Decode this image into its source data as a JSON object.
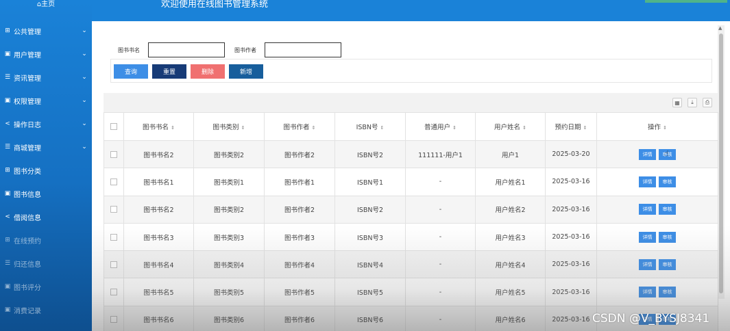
{
  "sidebar": {
    "home": "⌂主页",
    "items": [
      {
        "icon": "grid-icon",
        "glyph": "⊞",
        "label": "公共管理",
        "chevron": true
      },
      {
        "icon": "doc-icon",
        "glyph": "▣",
        "label": "用户管理",
        "chevron": true
      },
      {
        "icon": "list-icon",
        "glyph": "☰",
        "label": "资讯管理",
        "chevron": true
      },
      {
        "icon": "doc-icon",
        "glyph": "▣",
        "label": "权限管理",
        "chevron": true
      },
      {
        "icon": "share-icon",
        "glyph": "<",
        "label": "操作日志",
        "chevron": true
      },
      {
        "icon": "list-icon",
        "glyph": "☰",
        "label": "商城管理",
        "chevron": true
      },
      {
        "icon": "grid-icon",
        "glyph": "⊞",
        "label": "图书分类",
        "chevron": false
      },
      {
        "icon": "doc-icon",
        "glyph": "▣",
        "label": "图书信息",
        "chevron": false
      },
      {
        "icon": "share-icon",
        "glyph": "<",
        "label": "借阅信息",
        "chevron": false
      },
      {
        "icon": "grid-icon",
        "glyph": "⊞",
        "label": "在线预约",
        "chevron": false
      },
      {
        "icon": "list-icon",
        "glyph": "☰",
        "label": "归还信息",
        "chevron": false
      },
      {
        "icon": "doc-icon",
        "glyph": "▣",
        "label": "图书评分",
        "chevron": false
      },
      {
        "icon": "doc-icon",
        "glyph": "▣",
        "label": "消费记录",
        "chevron": false
      }
    ]
  },
  "header": {
    "title": "欢迎使用在线图书管理系统"
  },
  "search": {
    "name_label": "图书书名",
    "name_value": "",
    "author_label": "图书作者",
    "author_value": ""
  },
  "buttons": {
    "query": "查询",
    "reset": "重置",
    "delete": "删除",
    "add": "新增"
  },
  "table": {
    "columns": [
      "图书书名",
      "图书类别",
      "图书作者",
      "ISBN号",
      "普通用户",
      "用户姓名",
      "预约日期",
      "操作"
    ],
    "rows": [
      [
        "图书书名2",
        "图书类别2",
        "图书作者2",
        "ISBN号2",
        "111111-用户1",
        "用户1",
        "2025-03-20"
      ],
      [
        "图书书名1",
        "图书类别1",
        "图书作者1",
        "ISBN号1",
        "-",
        "用户姓名1",
        "2025-03-16"
      ],
      [
        "图书书名2",
        "图书类别2",
        "图书作者2",
        "ISBN号2",
        "-",
        "用户姓名2",
        "2025-03-16"
      ],
      [
        "图书书名3",
        "图书类别3",
        "图书作者3",
        "ISBN号3",
        "-",
        "用户姓名3",
        "2025-03-16"
      ],
      [
        "图书书名4",
        "图书类别4",
        "图书作者4",
        "ISBN号4",
        "-",
        "用户姓名4",
        "2025-03-16"
      ],
      [
        "图书书名5",
        "图书类别5",
        "图书作者5",
        "ISBN号5",
        "-",
        "用户姓名5",
        "2025-03-16"
      ],
      [
        "图书书名6",
        "图书类别6",
        "图书作者6",
        "ISBN号6",
        "-",
        "用户姓名6",
        "2025-03-16"
      ]
    ],
    "actions": {
      "detail": "详情",
      "review": "审核"
    }
  },
  "watermark": "CSDN @V_BYSJ8341",
  "colors": {
    "sidebar": "#1a82d8",
    "primary": "#3d8ee6",
    "reset": "#173b77",
    "delete": "#f07070",
    "add": "#175e9c"
  }
}
